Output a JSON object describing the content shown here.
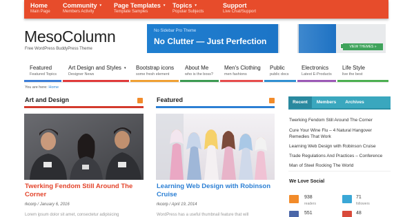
{
  "top_nav": [
    {
      "title": "Home",
      "subtitle": "Main Page",
      "has_caret": false
    },
    {
      "title": "Community",
      "subtitle": "Members Activity",
      "has_caret": true
    },
    {
      "title": "Page Templates",
      "subtitle": "Template Samples",
      "has_caret": true
    },
    {
      "title": "Topics",
      "subtitle": "Popular Subjects",
      "has_caret": true
    },
    {
      "title": "Support",
      "subtitle": "Live Chat/Support",
      "has_caret": false
    }
  ],
  "caret": "▾",
  "site": {
    "title": "MesoColumn",
    "tagline": "Free WordPress BuddyPress Theme"
  },
  "banner": {
    "line1": "No Sidebar Pro Theme",
    "line2": "No Clutter — Just Perfection",
    "button": "VIEW THEMES »"
  },
  "main_nav": [
    {
      "title": "Featured",
      "subtitle": "Featured Topics",
      "has_caret": false,
      "color": "#3b7dd8"
    },
    {
      "title": "Art Design and Styles",
      "subtitle": "Designer News",
      "has_caret": true,
      "color": "#e03a3a"
    },
    {
      "title": "Bootstrap icons",
      "subtitle": "some fresh element",
      "has_caret": false,
      "color": "#f0a033"
    },
    {
      "title": "About Me",
      "subtitle": "who is the boss?",
      "has_caret": false,
      "color": "#3c9a52"
    },
    {
      "title": "Men's Clothing",
      "subtitle": "men fashions",
      "has_caret": false,
      "color": "#e64c4c"
    },
    {
      "title": "Public",
      "subtitle": "public docs",
      "has_caret": false,
      "color": "#2f8fd1"
    },
    {
      "title": "Electronics",
      "subtitle": "Latest E-Products",
      "has_caret": false,
      "color": "#9b59b6"
    },
    {
      "title": "Life Style",
      "subtitle": "live the best",
      "has_caret": false,
      "color": "#4caf50"
    }
  ],
  "breadcrumb": {
    "prefix": "You are here:",
    "link": "Home"
  },
  "sections": {
    "left": {
      "title": "Art and Design",
      "color": "#d33a2c"
    },
    "middle": {
      "title": "Featured",
      "color": "#2b7fd4"
    }
  },
  "posts": {
    "left": {
      "title": "Twerking Fendom Still Around The Corner",
      "author": "rkcorp",
      "date": "January 6, 2016",
      "excerpt": "Lorem ipsum dolor sit amet, consectetur adipisicing"
    },
    "middle": {
      "title": "Learning Web Design with Robinson Cruise",
      "author": "rkcorp",
      "date": "April 19, 2014",
      "excerpt": "WordPress has a useful thumbnail feature that will"
    }
  },
  "meta_sep": "/",
  "sidebar": {
    "tabs": [
      "Recent",
      "Members",
      "Archives"
    ],
    "recent": [
      "Twerking Fendom Still Around The Corner",
      "Cure Your Wine Flu – 4 Natural Hangover Remedies That Work",
      "Learning Web Design with Robinson Cruise",
      "Trade Regulations And Practices – Conference",
      "Man of Steel Rocking The World"
    ],
    "social_title": "We Love Social",
    "social": [
      {
        "count": "938",
        "label": "readers",
        "color": "#f28b2a"
      },
      {
        "count": "71",
        "label": "followers",
        "color": "#3aa7d6"
      },
      {
        "count": "551",
        "label": "",
        "color": "#4a66a8"
      },
      {
        "count": "48",
        "label": "",
        "color": "#d94a3a"
      }
    ]
  }
}
